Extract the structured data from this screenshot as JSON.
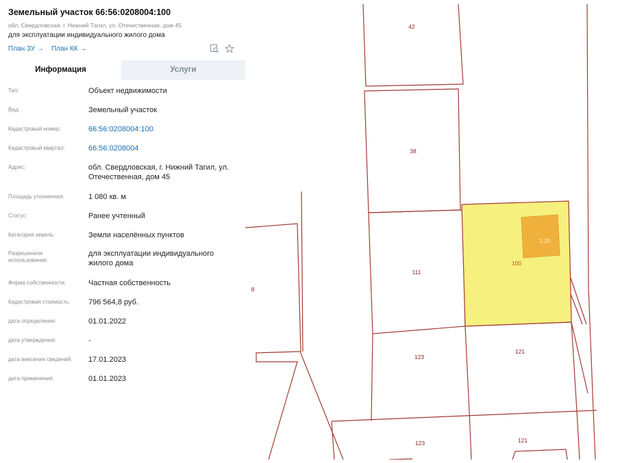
{
  "header": {
    "title": "Земельный участок 66:56:0208004:100",
    "address": "обл. Свердловская, г. Нижний Тагил, ул. Отечественная, дом 45",
    "use": "для эксплуатации индивидуального жилого дома",
    "link_plan_zu": "План ЗУ →",
    "link_plan_kk": "План КК →"
  },
  "icons": {
    "search_doc": "search-document-icon",
    "star": "star-icon"
  },
  "tabs": [
    {
      "label": "Информация",
      "active": true
    },
    {
      "label": "Услуги",
      "active": false
    }
  ],
  "info": [
    {
      "label": "Тип:",
      "value": "Объект недвижимости"
    },
    {
      "label": "Вид:",
      "value": "Земельный участок"
    },
    {
      "label": "Кадастровый номер:",
      "value": "66:56:0208004:100",
      "link": true
    },
    {
      "label": "Кадастровый квартал:",
      "value": "66:56:0208004",
      "link": true
    },
    {
      "label": "Адрес:",
      "value": "обл. Свердловская, г. Нижний Тагил, ул. Отечественная, дом 45"
    },
    {
      "label": "Площадь уточненная:",
      "value": "1 080 кв. м"
    },
    {
      "label": "Статус:",
      "value": "Ранее учтенный"
    },
    {
      "label": "Категория земель:",
      "value": "Земли населённых пунктов"
    },
    {
      "label": "Разрешенное использование:",
      "value": "для эксплуатации индивидуального жилого дома"
    },
    {
      "label": "Форма собственности:",
      "value": "Частная собственность"
    },
    {
      "label": "Кадастровая стоимость:",
      "value": "796 564,8 руб."
    },
    {
      "label": "дата определения:",
      "value": "01.01.2022"
    },
    {
      "label": "дата утверждения:",
      "value": "-"
    },
    {
      "label": "дата внесения сведений:",
      "value": "17.01.2023"
    },
    {
      "label": "дата применения:",
      "value": "01.01.2023"
    }
  ],
  "map": {
    "parcel_labels": [
      "42",
      "38",
      "111",
      "100",
      "8",
      "123",
      "121",
      "123",
      "121"
    ],
    "building_label": "1:20",
    "colors": {
      "boundary": "#a23a35",
      "selected_fill": "#f6f07e",
      "building_fill": "#f0b13c"
    }
  }
}
